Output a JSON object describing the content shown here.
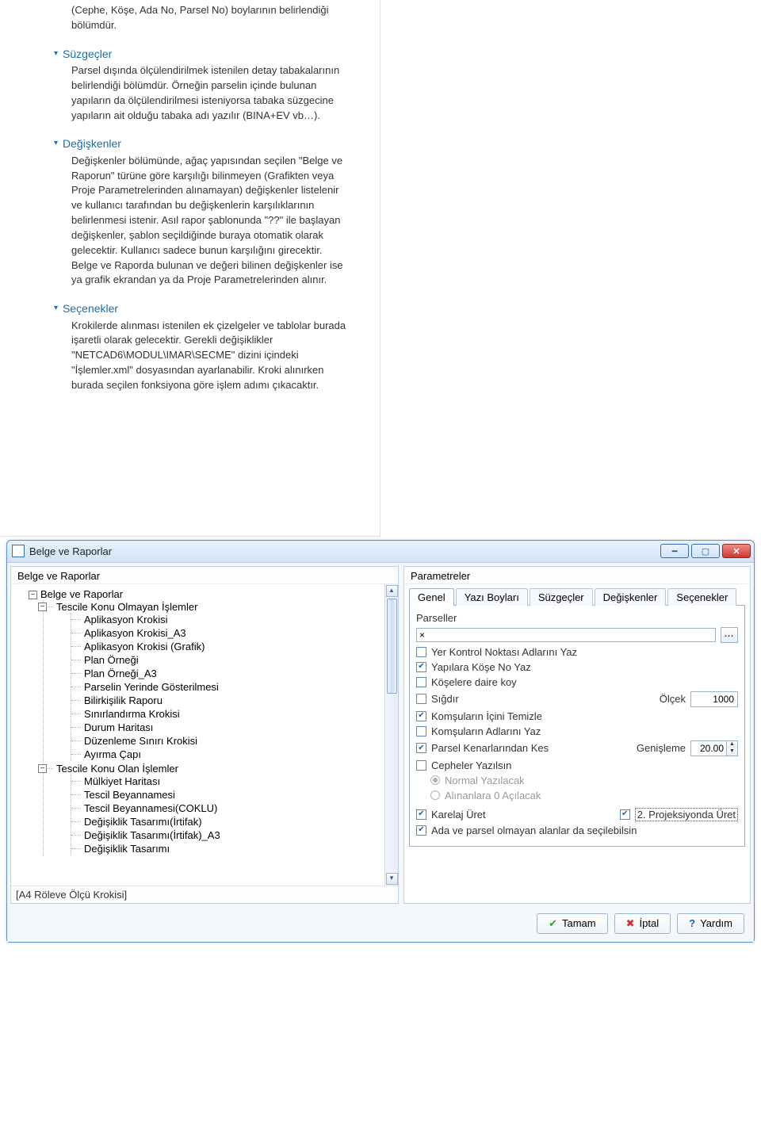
{
  "doc": {
    "preamble": "(Cephe, Köşe, Ada No, Parsel No) boylarının belirlendiği bölümdür.",
    "sections": {
      "suzgecler": {
        "title": "Süzgeçler",
        "body": "Parsel dışında ölçülendirilmek istenilen detay tabakalarının belirlendiği bölümdür. Örneğin parselin içinde bulunan yapıların da ölçülendirilmesi isteniyorsa tabaka süzgecine yapıların ait olduğu tabaka adı yazılır (BINA+EV vb…)."
      },
      "degiskenler": {
        "title": "Değişkenler",
        "body": "Değişkenler bölümünde, ağaç yapısından seçilen \"Belge ve Raporun\" türüne göre karşılığı bilinmeyen (Grafikten veya Proje Parametrelerinden alınamayan) değişkenler listelenir ve kullanıcı tarafından bu değişkenlerin karşılıklarının belirlenmesi istenir. Asıl rapor şablonunda \"??\" ile başlayan değişkenler, şablon seçildiğinde buraya otomatik olarak gelecektir. Kullanıcı sadece bunun karşılığını girecektir. Belge ve Raporda bulunan ve değeri bilinen değişkenler ise ya grafik ekrandan ya da Proje Parametrelerinden alınır."
      },
      "secenekler": {
        "title": "Seçenekler",
        "body": "Krokilerde alınması istenilen ek çizelgeler ve tablolar burada işaretli olarak gelecektir. Gerekli değişiklikler \"NETCAD6\\MODUL\\IMAR\\SECME\" dizini içindeki \"İşlemler.xml\" dosyasından ayarlanabilir. Kroki alınırken burada seçilen fonksiyona göre işlem adımı çıkacaktır."
      }
    }
  },
  "dialog": {
    "title": "Belge ve Raporlar",
    "left": {
      "header": "Belge ve Raporlar",
      "status": "[A4 Röleve Ölçü Krokisi]",
      "root": "Belge ve Raporlar",
      "group1": {
        "label": "Tescile Konu Olmayan İşlemler",
        "items": [
          "Aplikasyon Krokisi",
          "Aplikasyon Krokisi_A3",
          "Aplikasyon Krokisi (Grafik)",
          "Plan Örneği",
          "Plan Örneği_A3",
          "Parselin Yerinde Gösterilmesi",
          "Bilirkişilik Raporu",
          "Sınırlandırma Krokisi",
          "Durum Haritası",
          "Düzenleme Sınırı Krokisi",
          "Ayırma Çapı"
        ]
      },
      "group2": {
        "label": "Tescile Konu Olan İşlemler",
        "items": [
          "Mülkiyet Haritası",
          "Tescil Beyannamesi",
          "Tescil Beyannamesi(COKLU)",
          "Değişiklik Tasarımı(İrtifak)",
          "Değişiklik Tasarımı(İrtifak)_A3",
          "Değişiklik Tasarımı"
        ]
      }
    },
    "right": {
      "header": "Parametreler",
      "tabs": {
        "genel": "Genel",
        "yazi": "Yazı Boyları",
        "suzgec": "Süzgeçler",
        "degisken": "Değişkenler",
        "secenek": "Seçenekler"
      },
      "parseller_label": "Parseller",
      "parseller_value": "×",
      "browse": "...",
      "yerkontrol": "Yer Kontrol Noktası Adlarını Yaz",
      "yapilarakose": "Yapılara Köşe No Yaz",
      "koselere": "Köşelere daire koy",
      "sigdir": "Sığdır",
      "olcek_label": "Ölçek",
      "olcek_value": "1000",
      "komsuicini": "Komşuların İçini Temizle",
      "komsuadlari": "Komşuların Adlarını Yaz",
      "parselkenar": "Parsel Kenarlarından Kes",
      "genisleme_label": "Genişleme",
      "genisleme_value": "20.00",
      "cepheler": "Cepheler Yazılsın",
      "normal": "Normal Yazılacak",
      "alinanlara": "Alınanlara 0 Açılacak",
      "karelaj": "Karelaj Üret",
      "projeksiyon": "2. Projeksiyonda Üret",
      "adaparsel": "Ada ve parsel olmayan alanlar da seçilebilsin"
    },
    "buttons": {
      "ok": "Tamam",
      "cancel": "İptal",
      "help": "Yardım"
    }
  }
}
